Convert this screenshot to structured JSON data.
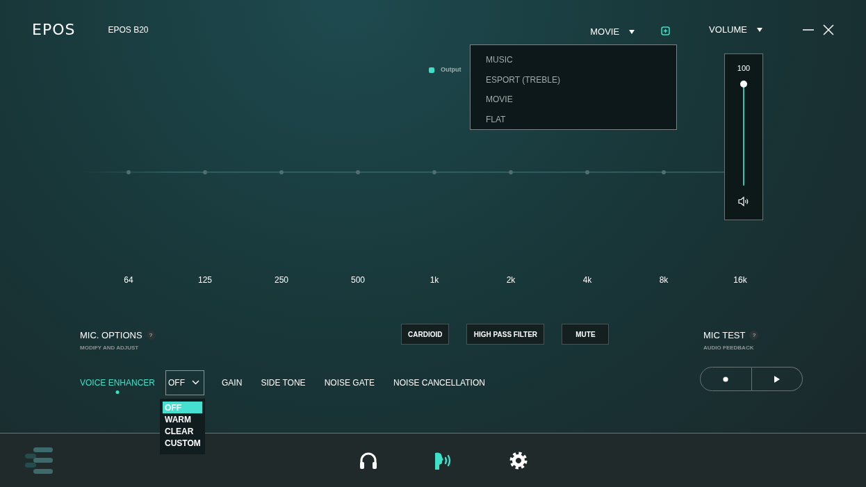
{
  "device": {
    "logo": "EPOS",
    "model": "EPOS B20"
  },
  "preset_selector": {
    "value": "MOVIE",
    "expanded": true
  },
  "preset_menu": [
    "MUSIC",
    "ESPORT (TREBLE)",
    "MOVIE",
    "FLAT"
  ],
  "volume_selector": {
    "label": "VOLUME",
    "expanded": true
  },
  "volume_popup": {
    "reading": "100",
    "level": 1.0
  },
  "equalizer": {
    "legend": "Output",
    "bands": [
      "64",
      "125",
      "250",
      "500",
      "1k",
      "2k",
      "4k",
      "8k",
      "16k"
    ]
  },
  "mic_options": {
    "title": "MIC. OPTIONS",
    "help": "?",
    "subtitle": "MODIFY AND ADJUST",
    "toggles": [
      "CARDIOID",
      "HIGH PASS FILTER",
      "MUTE"
    ]
  },
  "mic_tabs": [
    {
      "label": "VOICE ENHANCER",
      "selected": true
    },
    {
      "label": "GAIN",
      "selected": false
    },
    {
      "label": "SIDE TONE",
      "selected": false
    },
    {
      "label": "NOISE GATE",
      "selected": false
    },
    {
      "label": "NOISE CANCELLATION",
      "selected": false
    }
  ],
  "voice_enhancer_select": {
    "value": "OFF",
    "expanded": true,
    "options": [
      {
        "label": "OFF",
        "selected": true
      },
      {
        "label": "WARM",
        "selected": false
      },
      {
        "label": "CLEAR",
        "selected": false
      },
      {
        "label": "CUSTOM",
        "selected": false
      }
    ]
  },
  "mic_test": {
    "title": "MIC TEST",
    "help": "?",
    "subtitle": "AUDIO FEEDBACK"
  },
  "nav": [
    {
      "kind": "headphones",
      "selected": false
    },
    {
      "kind": "microphone",
      "selected": true
    },
    {
      "kind": "settings",
      "selected": false
    }
  ]
}
